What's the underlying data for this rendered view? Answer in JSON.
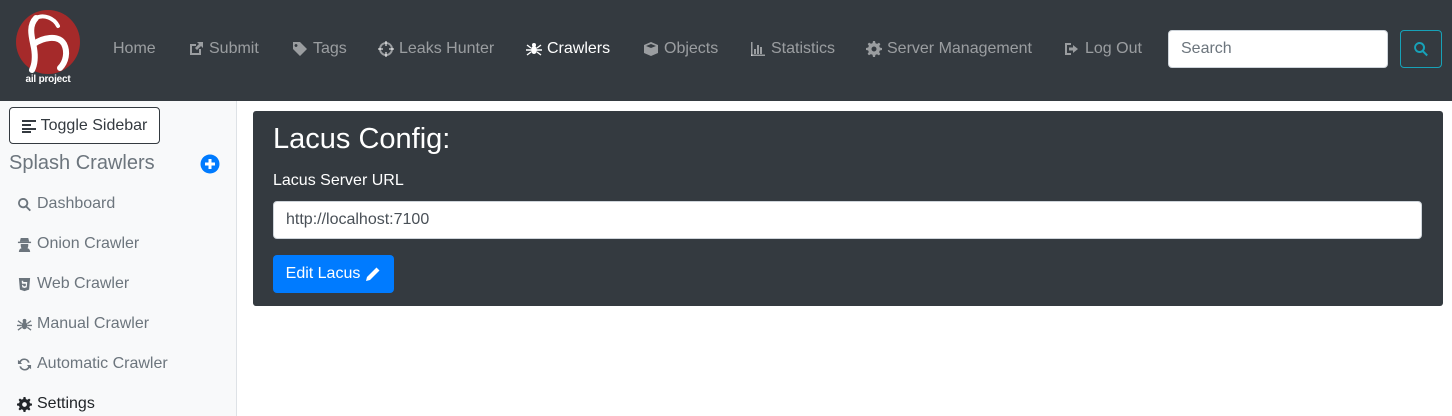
{
  "navbar": {
    "brand_text": "ail project",
    "items": [
      {
        "label": "Home",
        "icon": "none"
      },
      {
        "label": "Submit",
        "icon": "external-link-icon"
      },
      {
        "label": "Tags",
        "icon": "tag-icon"
      },
      {
        "label": "Leaks Hunter",
        "icon": "crosshairs-icon"
      },
      {
        "label": "Crawlers",
        "icon": "spider-icon"
      },
      {
        "label": "Objects",
        "icon": "cube-icon"
      },
      {
        "label": "Statistics",
        "icon": "bar-chart-icon"
      },
      {
        "label": "Server Management",
        "icon": "cog-icon"
      },
      {
        "label": "Log Out",
        "icon": "sign-out-icon"
      }
    ],
    "active_item": "Crawlers",
    "search_placeholder": "Search"
  },
  "sidebar": {
    "toggle_label": "Toggle Sidebar",
    "heading": "Splash Crawlers",
    "items": [
      {
        "label": "Dashboard",
        "icon": "search-icon"
      },
      {
        "label": "Onion Crawler",
        "icon": "user-secret-icon"
      },
      {
        "label": "Web Crawler",
        "icon": "html5-icon"
      },
      {
        "label": "Manual Crawler",
        "icon": "spider-icon"
      },
      {
        "label": "Automatic Crawler",
        "icon": "sync-icon"
      },
      {
        "label": "Settings",
        "icon": "cog-icon"
      }
    ],
    "active_item": "Settings"
  },
  "main": {
    "title": "Lacus Config:",
    "field_label": "Lacus Server URL",
    "url_value": "http://localhost:7100",
    "edit_button_label": "Edit Lacus"
  },
  "colors": {
    "navbar_bg": "#343a40",
    "card_bg": "#343a40",
    "primary": "#007bff",
    "info": "#17a2b8",
    "brand_red": "#a52a2a"
  }
}
